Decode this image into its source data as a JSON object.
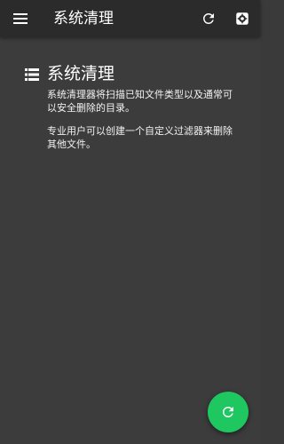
{
  "toolbar": {
    "title": "系统清理",
    "menu_icon": "menu-icon",
    "refresh_icon": "refresh-icon",
    "settings_icon": "settings-icon"
  },
  "main": {
    "section_icon": "list-icon",
    "title": "系统清理",
    "description_1": "系统清理器将扫描已知文件类型以及通常可以安全删除的目录。",
    "description_2": "专业用户可以创建一个自定义过滤器来删除其他文件。"
  },
  "fab": {
    "icon": "refresh-icon"
  },
  "colors": {
    "toolbar_bg": "#2b2b2b",
    "content_bg": "#3c3c3c",
    "fab_accent": "#1ec760",
    "text": "#ffffff"
  }
}
